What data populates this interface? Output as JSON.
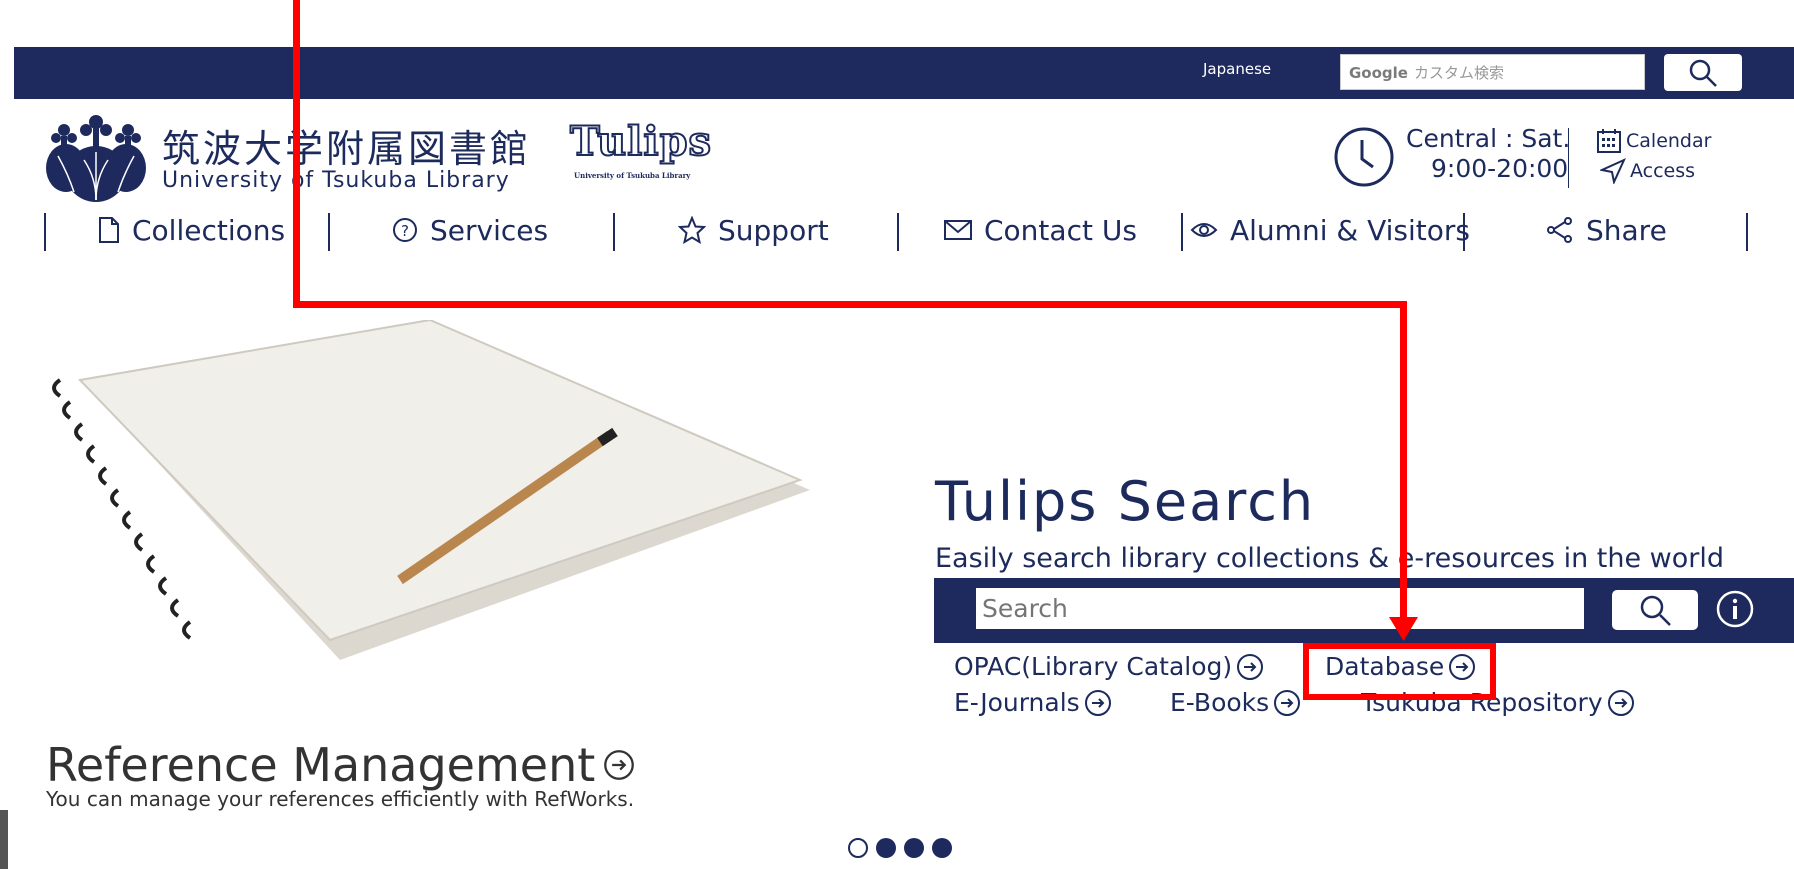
{
  "header": {
    "language_link": "Japanese",
    "google_search_logo": "Google",
    "google_search_placeholder": "カスタム検索",
    "search_icon": "search-icon"
  },
  "logo": {
    "japanese_name": "筑波大学附属図書館",
    "english_name": "University of Tsukuba Library",
    "tulips_text": "Tulips",
    "tulips_subtitle": "University of Tsukuba Library"
  },
  "hours": {
    "line1": "Central : Sat.",
    "line2": "9:00-20:00"
  },
  "quick_links": {
    "calendar": "Calendar",
    "access": "Access"
  },
  "nav": {
    "items": [
      {
        "label": "Collections",
        "icon": "document-icon"
      },
      {
        "label": "Services",
        "icon": "help-icon"
      },
      {
        "label": "Support",
        "icon": "star-icon"
      },
      {
        "label": "Contact Us",
        "icon": "mail-icon"
      },
      {
        "label": "Alumni & Visitors",
        "icon": "eye-icon"
      },
      {
        "label": "Share",
        "icon": "share-icon"
      }
    ]
  },
  "tulips_search": {
    "title": "Tulips Search",
    "subtitle": "Easily search library collections & e-resources in the world",
    "placeholder": "Search",
    "links": {
      "opac": "OPAC(Library Catalog)",
      "database": "Database",
      "ejournals": "E-Journals",
      "ebooks": "E-Books",
      "repository": "Tsukuba Repository"
    }
  },
  "reference": {
    "title": "Reference Management",
    "subtitle": "You can manage your references efficiently with RefWorks."
  },
  "carousel": {
    "total": 4,
    "active_index": 0
  },
  "colors": {
    "navy": "#1e2a5e",
    "annotation_red": "#ff0000"
  }
}
